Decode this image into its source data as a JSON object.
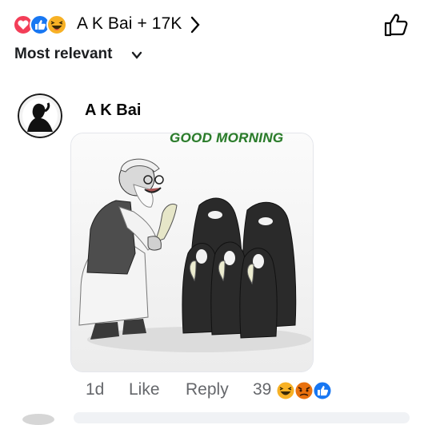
{
  "reactions_header": {
    "summary": "A K Bai + 17K",
    "icons": [
      "love-icon",
      "like-icon",
      "haha-icon"
    ]
  },
  "sort": {
    "label": "Most relevant"
  },
  "comment": {
    "author": "A K Bai",
    "image": {
      "caption": "GOOD MORNING",
      "description_icon": "illustration-image"
    },
    "actions": {
      "time": "1d",
      "like_label": "Like",
      "reply_label": "Reply"
    },
    "reaction_count": "39",
    "reaction_icons": [
      "haha-icon",
      "angry-icon",
      "like-icon"
    ]
  },
  "colors": {
    "like_blue": "#1877f2",
    "love_red": "#f33e58",
    "haha_yellow": "#f7b125",
    "meta_gray": "#65676b",
    "caption_green": "#2a7a2a"
  }
}
